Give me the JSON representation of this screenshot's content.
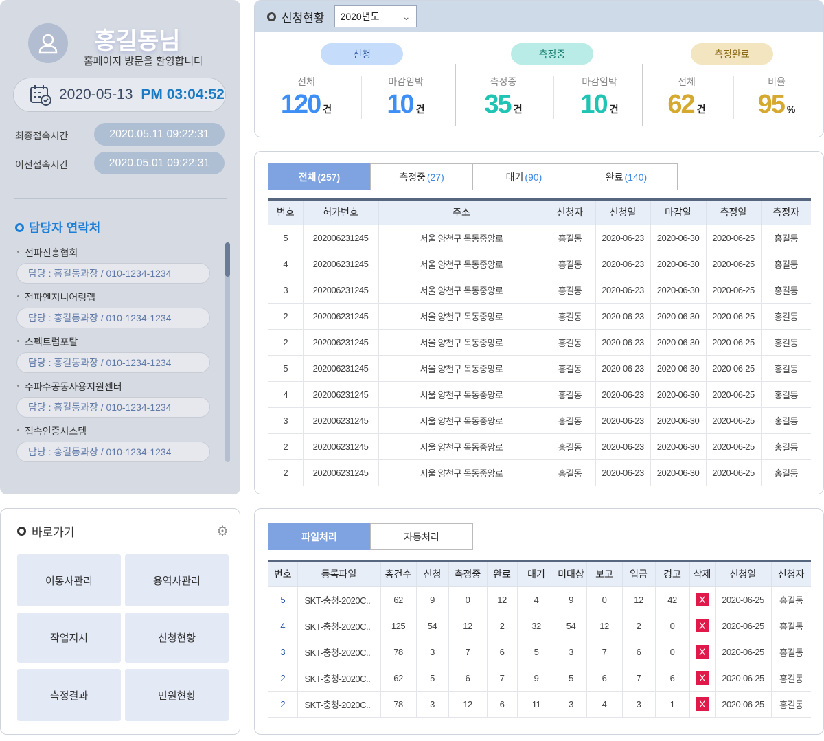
{
  "user": {
    "name": "홍길동님",
    "welcome": "홈페이지 방문을 환영합니다",
    "date": "2020-05-13",
    "time": "PM 03:04:52",
    "access": [
      {
        "label": "최종접속시간",
        "value": "2020.05.11 09:22:31"
      },
      {
        "label": "이전접속시간",
        "value": "2020.05.01 09:22:31"
      }
    ]
  },
  "contacts": {
    "title": "담당자 연락처",
    "items": [
      {
        "name": "전파진흥협회",
        "info": "담당 : 홍길동과장 /  010-1234-1234"
      },
      {
        "name": "전파엔지니어링랩",
        "info": "담당 : 홍길동과장 /  010-1234-1234"
      },
      {
        "name": "스펙트럼포탈",
        "info": "담당 : 홍길동과장 /  010-1234-1234"
      },
      {
        "name": "주파수공동사용지원센터",
        "info": "담당 : 홍길동과장 /  010-1234-1234"
      },
      {
        "name": "접속인증시스템",
        "info": "담당 : 홍길동과장 /  010-1234-1234"
      }
    ]
  },
  "shortcuts": {
    "title": "바로가기",
    "items": [
      "이통사관리",
      "용역사관리",
      "작업지시",
      "신청현황",
      "측정결과",
      "민원현황"
    ]
  },
  "status": {
    "title": "신청현황",
    "year": "2020년도",
    "groups": [
      {
        "label": "신청",
        "stats": [
          {
            "label": "전체",
            "value": "120",
            "unit": "건"
          },
          {
            "label": "마감임박",
            "value": "10",
            "unit": "건"
          }
        ]
      },
      {
        "label": "측정중",
        "stats": [
          {
            "label": "측정중",
            "value": "35",
            "unit": "건"
          },
          {
            "label": "마감임박",
            "value": "10",
            "unit": "건"
          }
        ]
      },
      {
        "label": "측정완료",
        "stats": [
          {
            "label": "전체",
            "value": "62",
            "unit": "건"
          },
          {
            "label": "비율",
            "value": "95",
            "unit": "%"
          }
        ]
      }
    ],
    "colors": [
      "#3d8ff5",
      "#1fc4b2",
      "#d5a92f"
    ]
  },
  "list": {
    "tabs": [
      {
        "label": "전체",
        "count": "(257)"
      },
      {
        "label": "측정중",
        "count": "(27)"
      },
      {
        "label": "대기",
        "count": "(90)"
      },
      {
        "label": "완료",
        "count": "(140)"
      }
    ],
    "columns": [
      "번호",
      "허가번호",
      "주소",
      "신청자",
      "신청일",
      "마감일",
      "측정일",
      "측정자"
    ],
    "rows": [
      [
        "5",
        "202006231245",
        "서울 양천구 목동중앙로",
        "홍길동",
        "2020-06-23",
        "2020-06-30",
        "2020-06-25",
        "홍길동"
      ],
      [
        "4",
        "202006231245",
        "서울 양천구 목동중앙로",
        "홍길동",
        "2020-06-23",
        "2020-06-30",
        "2020-06-25",
        "홍길동"
      ],
      [
        "3",
        "202006231245",
        "서울 양천구 목동중앙로",
        "홍길동",
        "2020-06-23",
        "2020-06-30",
        "2020-06-25",
        "홍길동"
      ],
      [
        "2",
        "202006231245",
        "서울 양천구 목동중앙로",
        "홍길동",
        "2020-06-23",
        "2020-06-30",
        "2020-06-25",
        "홍길동"
      ],
      [
        "2",
        "202006231245",
        "서울 양천구 목동중앙로",
        "홍길동",
        "2020-06-23",
        "2020-06-30",
        "2020-06-25",
        "홍길동"
      ],
      [
        "5",
        "202006231245",
        "서울 양천구 목동중앙로",
        "홍길동",
        "2020-06-23",
        "2020-06-30",
        "2020-06-25",
        "홍길동"
      ],
      [
        "4",
        "202006231245",
        "서울 양천구 목동중앙로",
        "홍길동",
        "2020-06-23",
        "2020-06-30",
        "2020-06-25",
        "홍길동"
      ],
      [
        "3",
        "202006231245",
        "서울 양천구 목동중앙로",
        "홍길동",
        "2020-06-23",
        "2020-06-30",
        "2020-06-25",
        "홍길동"
      ],
      [
        "2",
        "202006231245",
        "서울 양천구 목동중앙로",
        "홍길동",
        "2020-06-23",
        "2020-06-30",
        "2020-06-25",
        "홍길동"
      ],
      [
        "2",
        "202006231245",
        "서울 양천구 목동중앙로",
        "홍길동",
        "2020-06-23",
        "2020-06-30",
        "2020-06-25",
        "홍길동"
      ]
    ]
  },
  "files": {
    "tabs": [
      "파일처리",
      "자동처리"
    ],
    "columns": [
      "번호",
      "등록파일",
      "총건수",
      "신청",
      "측정중",
      "완료",
      "대기",
      "미대상",
      "보고",
      "입금",
      "경고",
      "삭제",
      "신청일",
      "신청자"
    ],
    "delete_glyph": "X",
    "rows": [
      [
        "5",
        "SKT-충청-2020C..",
        "62",
        "9",
        "0",
        "12",
        "4",
        "9",
        "0",
        "12",
        "42",
        "",
        "2020-06-25",
        "홍길동"
      ],
      [
        "4",
        "SKT-충청-2020C..",
        "125",
        "54",
        "12",
        "2",
        "32",
        "54",
        "12",
        "2",
        "0",
        "",
        "2020-06-25",
        "홍길동"
      ],
      [
        "3",
        "SKT-충청-2020C..",
        "78",
        "3",
        "7",
        "6",
        "5",
        "3",
        "7",
        "6",
        "0",
        "",
        "2020-06-25",
        "홍길동"
      ],
      [
        "2",
        "SKT-충청-2020C..",
        "62",
        "5",
        "6",
        "7",
        "9",
        "5",
        "6",
        "7",
        "6",
        "",
        "2020-06-25",
        "홍길동"
      ],
      [
        "2",
        "SKT-충청-2020C..",
        "78",
        "3",
        "12",
        "6",
        "11",
        "3",
        "4",
        "3",
        "1",
        "",
        "2020-06-25",
        "홍길동"
      ]
    ]
  }
}
